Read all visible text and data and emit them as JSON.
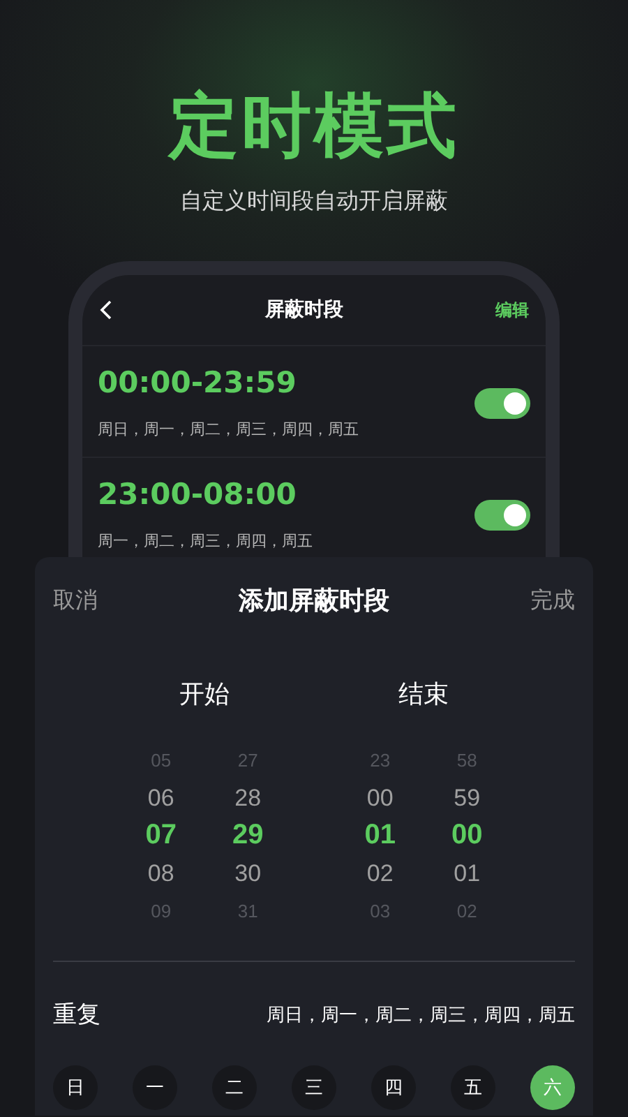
{
  "headline": "定时模式",
  "subtitle": "自定义时间段自动开启屏蔽",
  "phone": {
    "title": "屏蔽时段",
    "action": "编辑",
    "periods": [
      {
        "time": "00:00-23:59",
        "days": "周日，周一，周二，周三，周四，周五",
        "on": true
      },
      {
        "time": "23:00-08:00",
        "days": "周一，周二，周三，周四，周五",
        "on": true
      }
    ]
  },
  "sheet": {
    "cancel": "取消",
    "title": "添加屏蔽时段",
    "done": "完成",
    "pickers": [
      {
        "label": "开始",
        "columns": [
          {
            "items": [
              {
                "value": "05",
                "selected": false
              },
              {
                "value": "06",
                "selected": false
              },
              {
                "value": "07",
                "selected": true
              },
              {
                "value": "08",
                "selected": false
              },
              {
                "value": "09",
                "selected": false
              }
            ]
          },
          {
            "items": [
              {
                "value": "27",
                "selected": false
              },
              {
                "value": "28",
                "selected": false
              },
              {
                "value": "29",
                "selected": true
              },
              {
                "value": "30",
                "selected": false
              },
              {
                "value": "31",
                "selected": false
              }
            ]
          }
        ]
      },
      {
        "label": "结束",
        "columns": [
          {
            "items": [
              {
                "value": "23",
                "selected": false
              },
              {
                "value": "00",
                "selected": false
              },
              {
                "value": "01",
                "selected": true
              },
              {
                "value": "02",
                "selected": false
              },
              {
                "value": "03",
                "selected": false
              }
            ]
          },
          {
            "items": [
              {
                "value": "58",
                "selected": false
              },
              {
                "value": "59",
                "selected": false
              },
              {
                "value": "00",
                "selected": true
              },
              {
                "value": "01",
                "selected": false
              },
              {
                "value": "02",
                "selected": false
              }
            ]
          }
        ]
      }
    ],
    "repeat_label": "重复",
    "repeat_value": "周日，周一，周二，周三，周四，周五",
    "days": [
      {
        "label": "日",
        "selected": false
      },
      {
        "label": "一",
        "selected": false
      },
      {
        "label": "二",
        "selected": false
      },
      {
        "label": "三",
        "selected": false
      },
      {
        "label": "四",
        "selected": false
      },
      {
        "label": "五",
        "selected": false
      },
      {
        "label": "六",
        "selected": true
      }
    ]
  }
}
